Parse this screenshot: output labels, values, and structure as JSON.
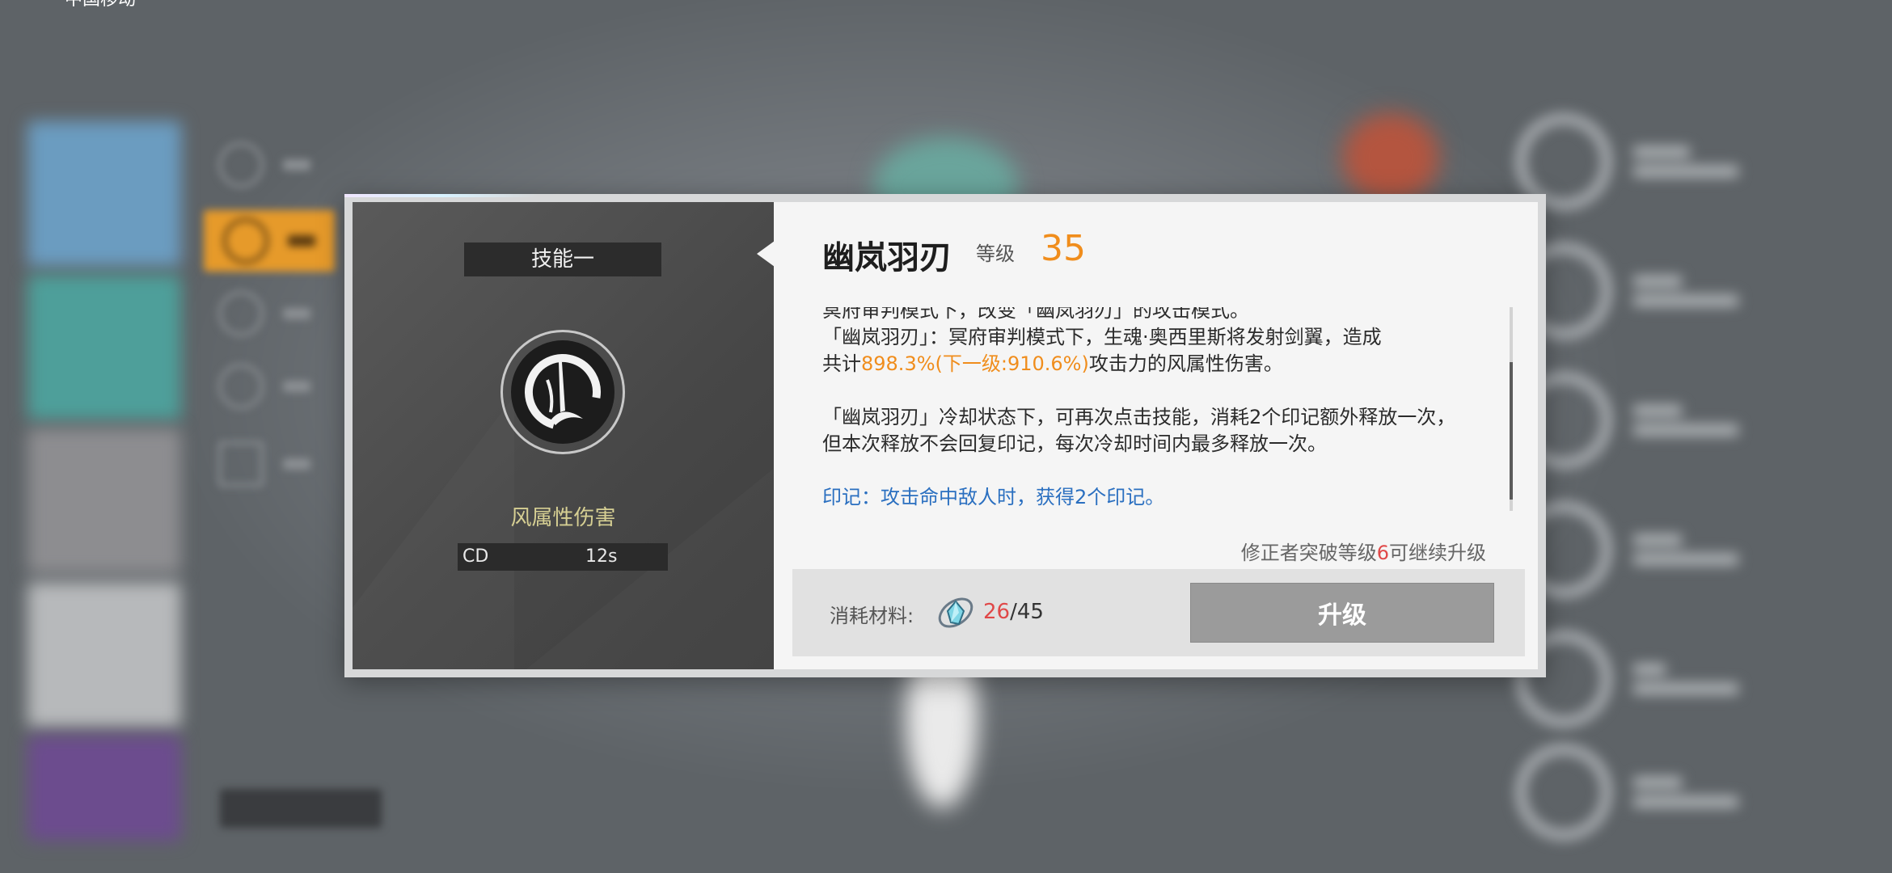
{
  "status_bar": {
    "carrier": "中国移动"
  },
  "dialog": {
    "skill_tag": "技能一",
    "element": "风属性伤害",
    "cd_label": "CD",
    "cd_value": "12s",
    "skill_name": "幽岚羽刃",
    "level_label": "等级",
    "level_value": "35",
    "description": {
      "line_cut": "冥府审判模式下，改变「幽岚羽刃」的攻击模式。",
      "p1_a": "「幽岚羽刃」：冥府审判模式下，生魂·奥西里斯将发射剑翼，造成",
      "p1_b_prefix": "共计",
      "p1_b_value": "898.3%(下一级:910.6%)",
      "p1_b_suffix": "攻击力的风属性伤害。",
      "p2": "「幽岚羽刃」冷却状态下，可再次点击技能，消耗2个印记额外释放一次，但本次释放不会回复印记，每次冷却时间内最多释放一次。",
      "p3": "印记：攻击命中敌人时，获得2个印记。"
    },
    "upgrade_note_prefix": "修正者突破等级",
    "upgrade_note_value": "6",
    "upgrade_note_suffix": "可继续升级",
    "material_label": "消耗材料:",
    "material_have": "26",
    "material_need": "/45",
    "upgrade_button": "升级"
  },
  "colors": {
    "accent_orange": "#f08d1c",
    "warning_red": "#e04848",
    "info_blue": "#2a6fc0",
    "element_yellow": "#d6cf93"
  }
}
